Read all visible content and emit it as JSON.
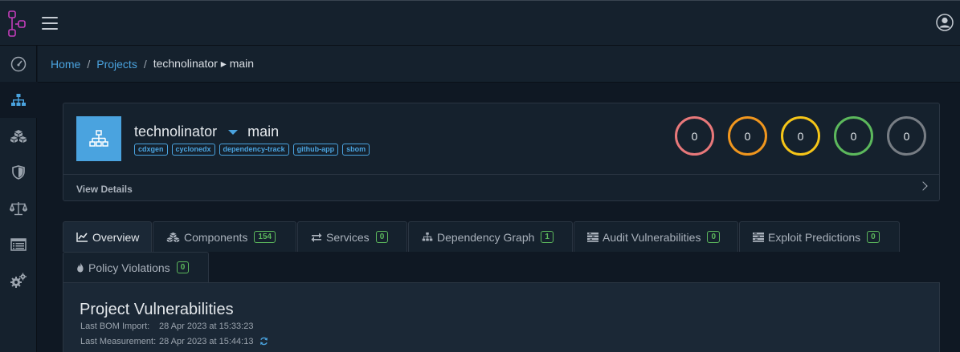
{
  "header": {
    "logo_icon": "dependency-track-logo",
    "menu_icon": "hamburger-icon",
    "user_icon": "user-circle-icon"
  },
  "sidebar": {
    "items": [
      {
        "name": "dashboard",
        "icon": "speedometer-icon"
      },
      {
        "name": "projects",
        "icon": "sitemap-icon"
      },
      {
        "name": "components",
        "icon": "cubes-icon"
      },
      {
        "name": "vulnerabilities",
        "icon": "shield-icon"
      },
      {
        "name": "licenses",
        "icon": "balance-scale-icon"
      },
      {
        "name": "tags",
        "icon": "list-icon"
      },
      {
        "name": "administration",
        "icon": "gears-icon"
      }
    ]
  },
  "breadcrumb": {
    "home": "Home",
    "projects": "Projects",
    "current": "technolinator ▸ main"
  },
  "project": {
    "name": "technolinator",
    "version": "main",
    "tags": [
      "cdxgen",
      "cyclonedx",
      "dependency-track",
      "github-app",
      "sbom"
    ],
    "severity_counts": [
      {
        "label": "critical",
        "value": "0",
        "color": "#e8787a"
      },
      {
        "label": "high",
        "value": "0",
        "color": "#f0961e"
      },
      {
        "label": "medium",
        "value": "0",
        "color": "#f5c518"
      },
      {
        "label": "low",
        "value": "0",
        "color": "#5cb85c"
      },
      {
        "label": "unassigned",
        "value": "0",
        "color": "#777d84"
      }
    ],
    "view_details": "View Details"
  },
  "tabs": [
    {
      "label": "Overview",
      "icon": "line-chart-icon",
      "badge": null
    },
    {
      "label": "Components",
      "icon": "cubes-icon",
      "badge": "154"
    },
    {
      "label": "Services",
      "icon": "exchange-icon",
      "badge": "0"
    },
    {
      "label": "Dependency Graph",
      "icon": "sitemap-icon",
      "badge": "1"
    },
    {
      "label": "Audit Vulnerabilities",
      "icon": "tasks-icon",
      "badge": "0"
    },
    {
      "label": "Exploit Predictions",
      "icon": "tasks-icon",
      "badge": "0"
    },
    {
      "label": "Policy Violations",
      "icon": "fire-icon",
      "badge": "0"
    }
  ],
  "overview": {
    "title": "Project Vulnerabilities",
    "last_bom_import_label": "Last BOM Import:",
    "last_bom_import_value": "28 Apr 2023 at 15:33:23",
    "last_measurement_label": "Last Measurement:",
    "last_measurement_value": "28 Apr 2023 at 15:44:13"
  },
  "colors": {
    "accent": "#4aa3df",
    "badge": "#5cb85c",
    "background": "#0f1823",
    "panel": "#15212d"
  }
}
